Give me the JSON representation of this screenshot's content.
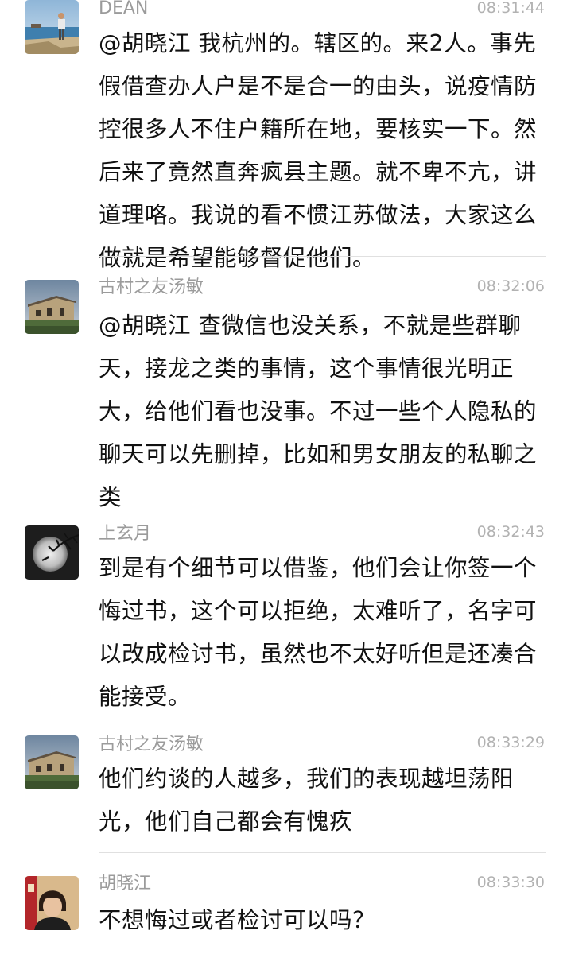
{
  "messages": [
    {
      "sender": "DEAN",
      "time": "08:31:44",
      "avatar": "beach-person-avatar",
      "text": "@胡晓江 我杭州的。辖区的。来2人。事先假借查办人户是不是合一的由头，说疫情防控很多人不住户籍所在地，要核实一下。然后来了竟然直奔疯县主题。就不卑不亢，讲道理咯。我说的看不惯江苏做法，大家这么做就是希望能够督促他们。"
    },
    {
      "sender": "古村之友汤敏",
      "time": "08:32:06",
      "avatar": "old-building-avatar",
      "text": "@胡晓江 查微信也没关系，不就是些群聊天，接龙之类的事情，这个事情很光明正大，给他们看也没事。不过一些个人隐私的聊天可以先删掉，比如和男女朋友的私聊之类"
    },
    {
      "sender": "上玄月",
      "time": "08:32:43",
      "avatar": "moon-tree-avatar",
      "text": "到是有个细节可以借鉴，他们会让你签一个悔过书，这个可以拒绝，太难听了，名字可以改成检讨书，虽然也不太好听但是还凑合能接受。"
    },
    {
      "sender": "古村之友汤敏",
      "time": "08:33:29",
      "avatar": "old-building-avatar",
      "text": "他们约谈的人越多，我们的表现越坦荡阳光，他们自己都会有愧疚"
    },
    {
      "sender": "胡晓江",
      "time": "08:33:30",
      "avatar": "woman-portrait-avatar",
      "text": "不想悔过或者检讨可以吗？"
    }
  ]
}
